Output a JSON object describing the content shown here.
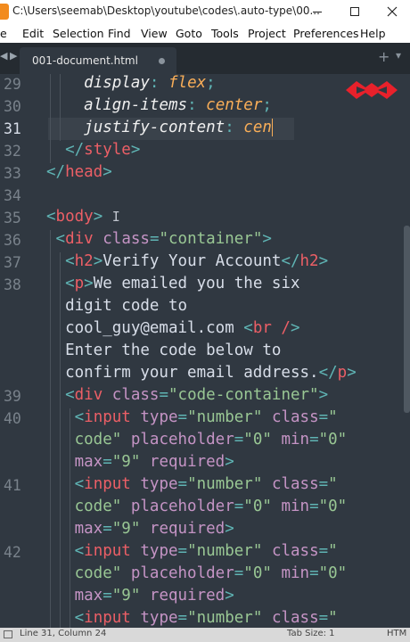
{
  "window": {
    "title": "C:\\Users\\seemab\\Desktop\\youtube\\codes\\.auto-type\\00...",
    "minimize_label": "—",
    "maximize_label": "☐",
    "close_label": "✕"
  },
  "menu": [
    "Edit",
    "Selection",
    "Find",
    "View",
    "Goto",
    "Tools",
    "Project",
    "Preferences",
    "Help"
  ],
  "menu_prefix": "e",
  "tabs": {
    "nav_left": "◀",
    "nav_right": "▶",
    "active_label": "001-document.html",
    "add": "+",
    "more": "▾"
  },
  "editor": {
    "line_numbers": [
      "29",
      "30",
      "31",
      "32",
      "33",
      "34",
      "35",
      "36",
      "37",
      "38",
      "",
      "",
      "",
      "",
      "39",
      "40",
      "",
      "",
      "41",
      "",
      "",
      "42",
      "",
      "",
      ""
    ],
    "current_line": "31",
    "cursor_char": "I"
  },
  "code": {
    "l29_prop": "display",
    "l29_val": "flex",
    "l30_prop": "align-items",
    "l30_val": "center",
    "l31_prop": "justify-content",
    "l31_val": "cen",
    "l32_tag": "style",
    "l33_tag": "head",
    "l35_tag": "body",
    "l36_tag": "div",
    "l36_attr": "class",
    "l36_val": "\"container\"",
    "l37_tag": "h2",
    "l37_text": "Verify Your Account",
    "l38_tag": "p",
    "l38_text1": "We emailed you the six",
    "l38_text2": "digit code to",
    "l38_text3": "cool_guy@email.com ",
    "l38_br": "br /",
    "l38_text4": "Enter the code below to",
    "l38_text5": "confirm your email address.",
    "l39_tag": "div",
    "l39_attr": "class",
    "l39_val": "\"code-container\"",
    "input_tag": "input",
    "input_type_attr": "type",
    "input_type_val": "\"number\"",
    "input_class_attr": "class",
    "input_class_val_a": "\"",
    "input_class_val_b": "code\"",
    "input_ph_attr": "placeholder",
    "input_ph_val": "\"0\"",
    "input_min_attr": "min",
    "input_min_val": "\"0\"",
    "input_max_attr": "max",
    "input_max_val": "\"9\"",
    "input_req_attr": "required"
  },
  "status": {
    "position": "Line 31, Column 24",
    "tab_size": "Tab Size: 1",
    "syntax": "HTM"
  },
  "colors": {
    "background": "#303841",
    "tag": "#ec5f66",
    "attribute": "#c594c5",
    "string": "#99c794",
    "value": "#f9ae58",
    "punctuation": "#5fb4b4"
  }
}
